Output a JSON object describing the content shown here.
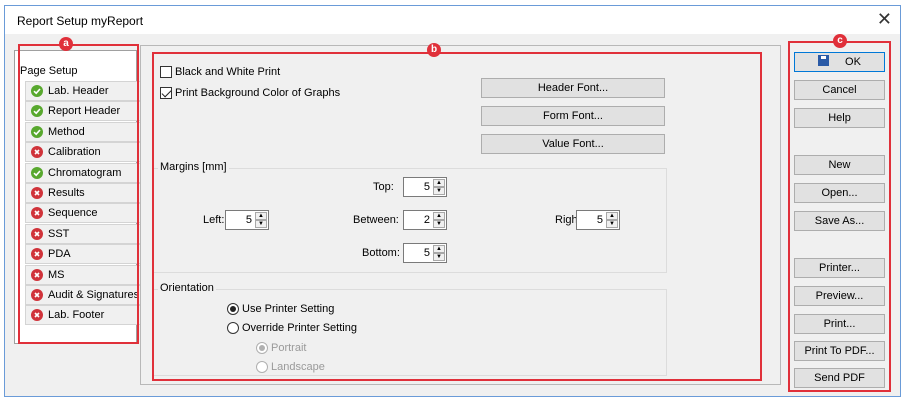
{
  "window": {
    "title": "Report Setup myReport",
    "close_glyph": "✕"
  },
  "badges": {
    "a": "a",
    "b": "b",
    "c": "c"
  },
  "nav": {
    "header": "Page Setup",
    "items": [
      {
        "label": "Lab. Header",
        "status": "ok"
      },
      {
        "label": "Report Header",
        "status": "ok"
      },
      {
        "label": "Method",
        "status": "ok"
      },
      {
        "label": "Calibration",
        "status": "error"
      },
      {
        "label": "Chromatogram",
        "status": "ok"
      },
      {
        "label": "Results",
        "status": "error"
      },
      {
        "label": "Sequence",
        "status": "error"
      },
      {
        "label": "SST",
        "status": "error"
      },
      {
        "label": "PDA",
        "status": "error"
      },
      {
        "label": "MS",
        "status": "error"
      },
      {
        "label": "Audit & Signatures",
        "status": "error"
      },
      {
        "label": "Lab. Footer",
        "status": "error"
      }
    ]
  },
  "page_setup": {
    "black_white_print": {
      "label": "Black and White Print",
      "checked": false
    },
    "print_bg_color": {
      "label": "Print Background Color of Graphs",
      "checked": true
    },
    "header_font_btn": "Header Font...",
    "form_font_btn": "Form Font...",
    "value_font_btn": "Value Font...",
    "margins": {
      "title": "Margins [mm]",
      "top": {
        "label": "Top:",
        "value": "5"
      },
      "left": {
        "label": "Left:",
        "value": "5"
      },
      "between": {
        "label": "Between:",
        "value": "2"
      },
      "right": {
        "label": "Right:",
        "value": "5"
      },
      "bottom": {
        "label": "Bottom:",
        "value": "5"
      }
    },
    "orientation": {
      "title": "Orientation",
      "use_printer": "Use Printer Setting",
      "override_printer": "Override Printer Setting",
      "portrait": "Portrait",
      "landscape": "Landscape"
    }
  },
  "actions": {
    "ok": "OK",
    "cancel": "Cancel",
    "help": "Help",
    "new": "New",
    "open": "Open...",
    "save_as": "Save As...",
    "printer": "Printer...",
    "preview": "Preview...",
    "print": "Print...",
    "print_pdf": "Print To PDF...",
    "send_pdf": "Send PDF"
  },
  "colors": {
    "annotation_red": "#e0303a",
    "ok_green": "#58a82e",
    "error_red": "#d0333a"
  }
}
